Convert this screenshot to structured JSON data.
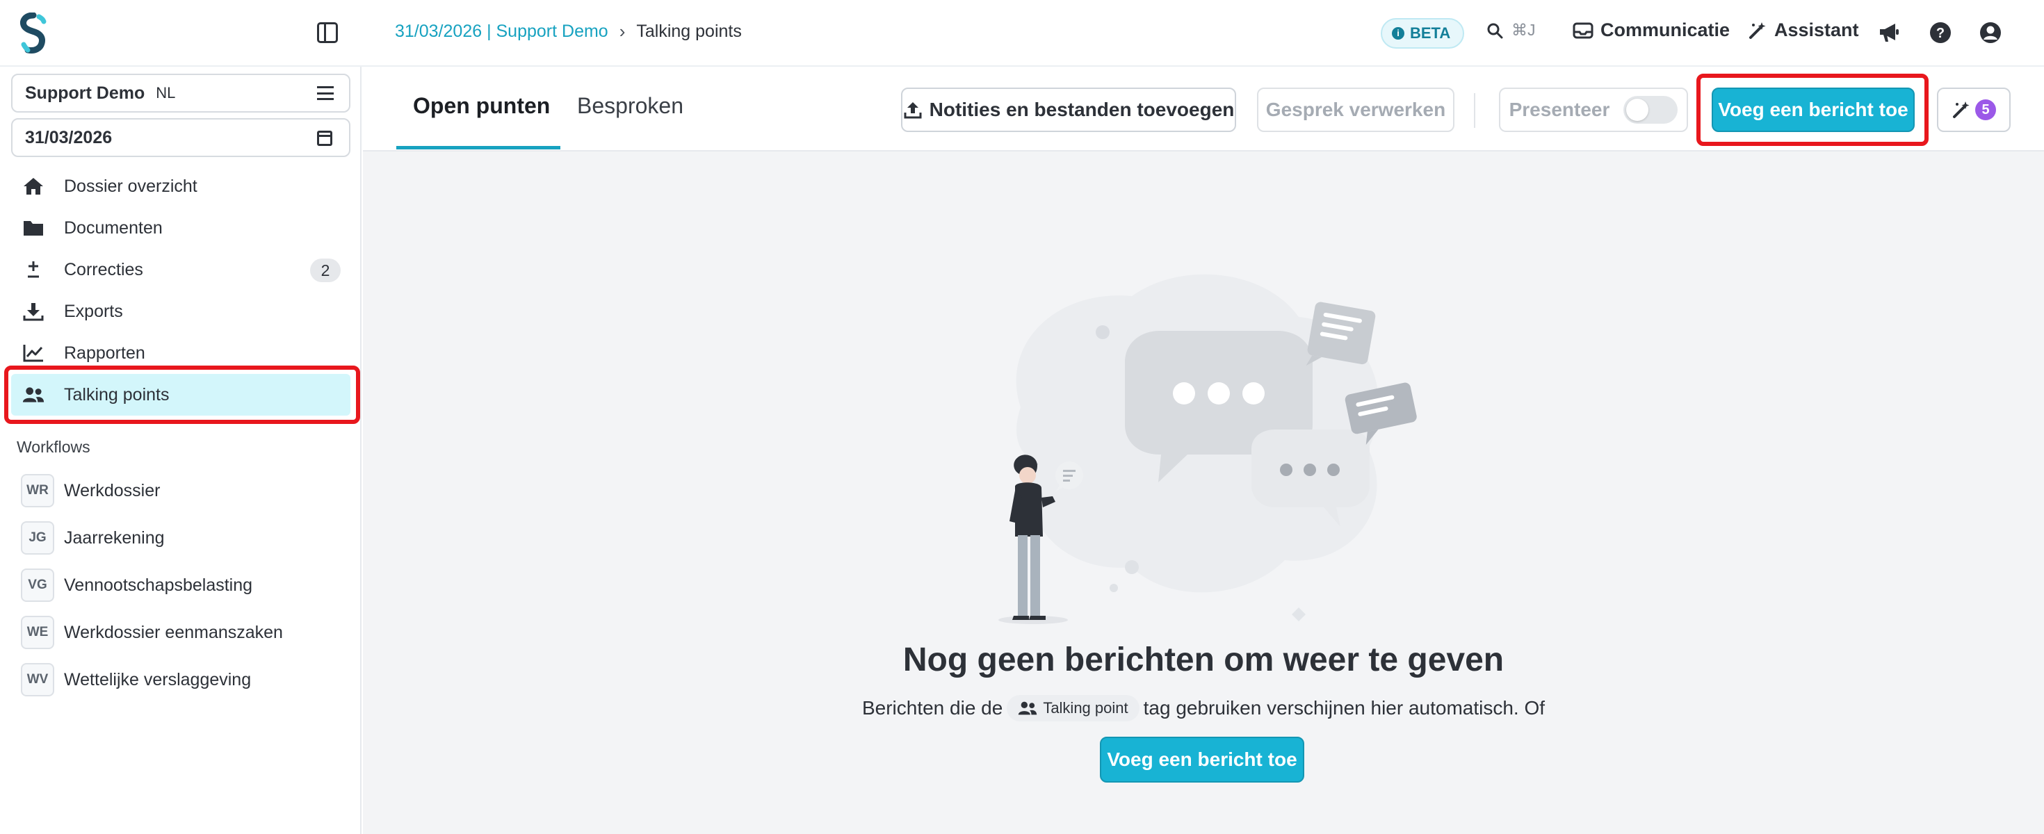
{
  "header": {
    "breadcrumb": {
      "link": "31/03/2026 | Support Demo",
      "current": "Talking points"
    },
    "beta_label": "BETA",
    "search_shortcut": "⌘J",
    "communicatie_label": "Communicatie",
    "assistant_label": "Assistant"
  },
  "sidebar": {
    "org_name": "Support Demo",
    "org_lang": "NL",
    "date": "31/03/2026",
    "nav": [
      {
        "label": "Dossier overzicht",
        "icon": "home-icon"
      },
      {
        "label": "Documenten",
        "icon": "folder-icon"
      },
      {
        "label": "Correcties",
        "icon": "plus-minus-icon",
        "count": "2"
      },
      {
        "label": "Exports",
        "icon": "download-icon"
      },
      {
        "label": "Rapporten",
        "icon": "chart-line-icon"
      },
      {
        "label": "Talking points",
        "icon": "users-icon",
        "active": true
      }
    ],
    "workflows_label": "Workflows",
    "workflows": [
      {
        "abbr": "WR",
        "label": "Werkdossier"
      },
      {
        "abbr": "JG",
        "label": "Jaarrekening"
      },
      {
        "abbr": "VG",
        "label": "Vennootschapsbelasting"
      },
      {
        "abbr": "WE",
        "label": "Werkdossier eenmanszaken"
      },
      {
        "abbr": "WV",
        "label": "Wettelijke verslaggeving"
      }
    ]
  },
  "main": {
    "tabs": [
      {
        "label": "Open punten",
        "active": true
      },
      {
        "label": "Besproken",
        "active": false
      }
    ],
    "toolbar": {
      "notes_label": "Notities en bestanden toevoegen",
      "process_label": "Gesprek verwerken",
      "present_label": "Presenteer",
      "add_message_label": "Voeg een bericht toe",
      "ai_count": "5"
    },
    "empty_state": {
      "title": "Nog geen berichten om weer te geven",
      "desc_before": "Berichten die de",
      "tag_label": "Talking point",
      "desc_after": "tag gebruiken verschijnen hier automatisch. Of",
      "button_label": "Voeg een bericht toe"
    }
  },
  "colors": {
    "accent": "#18b3d4",
    "link": "#17a2c0",
    "active_nav_bg": "#d3f6fb",
    "highlight": "#e8171d",
    "badge_purple": "#9b59e8"
  }
}
